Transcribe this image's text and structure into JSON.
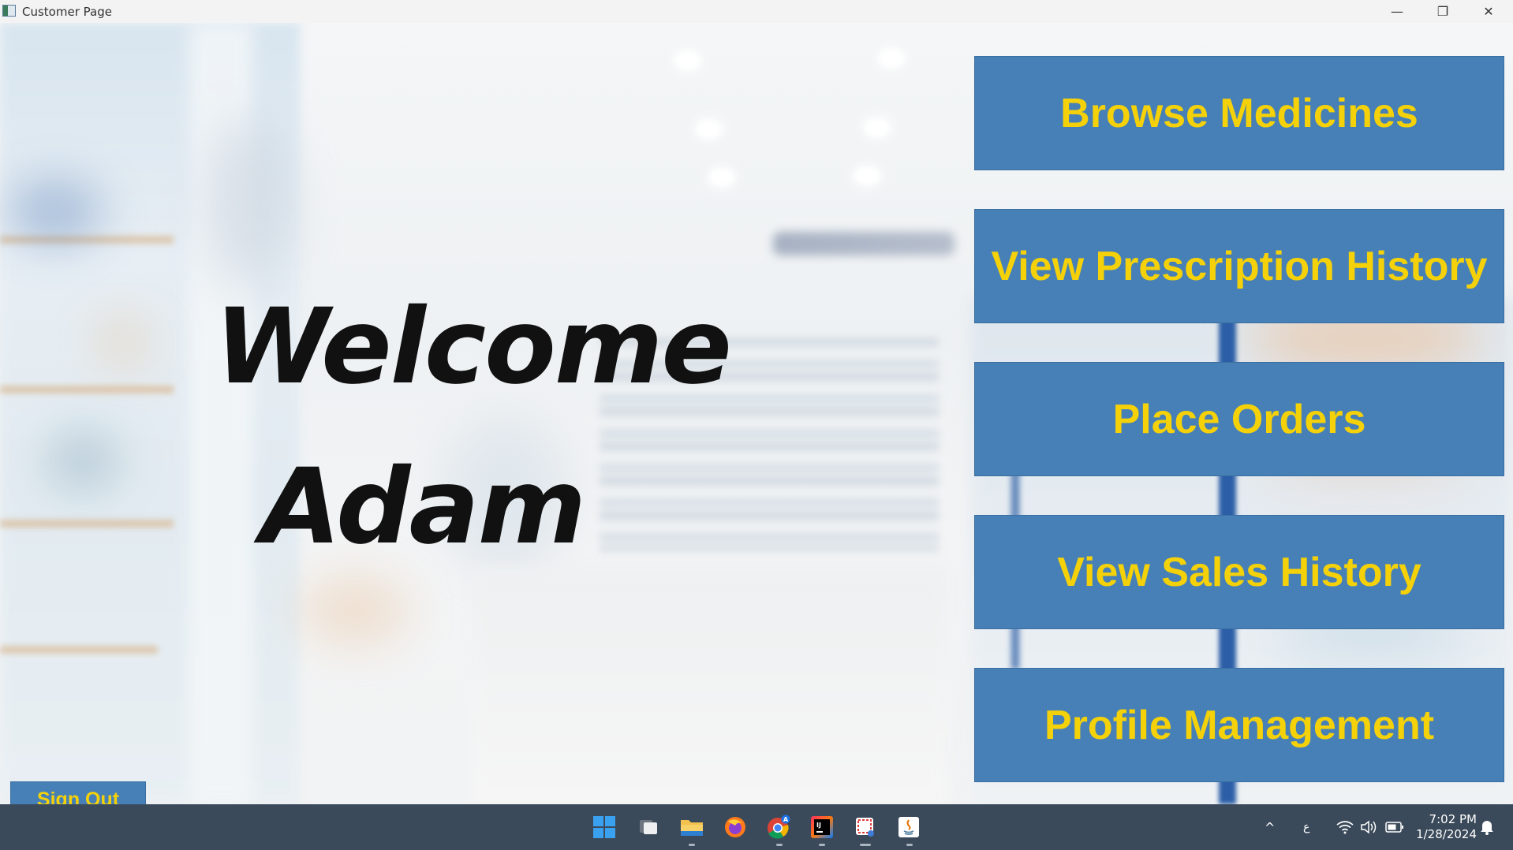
{
  "window": {
    "title": "Customer Page",
    "minimize_glyph": "—",
    "maximize_glyph": "❐",
    "close_glyph": "✕"
  },
  "welcome": {
    "line1": "Welcome",
    "line2": "Adam"
  },
  "menu": {
    "browse_medicines": "Browse Medicines",
    "view_prescription_history": "View Prescription History",
    "place_orders": "Place Orders",
    "view_sales_history": "View Sales History",
    "profile_management": "Profile Management"
  },
  "sign_out": "Sign Out",
  "colors": {
    "button_bg": "#4680b6",
    "button_text": "#f5d10a",
    "taskbar_bg": "#3b4a5a"
  },
  "taskbar": {
    "icons": [
      "windows-start-icon",
      "task-view-icon",
      "file-explorer-icon",
      "firefox-icon",
      "chrome-icon",
      "intellij-icon",
      "snipping-tool-icon",
      "java-icon"
    ],
    "tray": {
      "chevron": "^",
      "language": "ع",
      "time": "7:02 PM",
      "date": "1/28/2024"
    }
  }
}
